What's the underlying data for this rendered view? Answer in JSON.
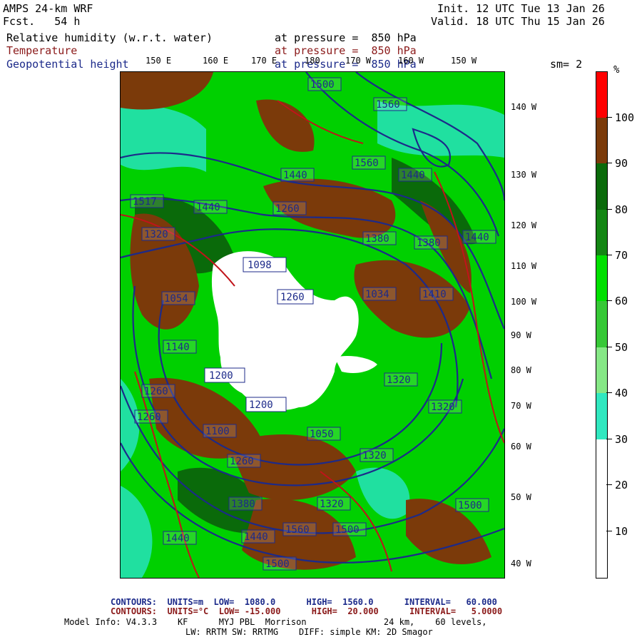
{
  "header": {
    "model_line": "AMPS 24-km WRF",
    "fcst_line": "Fcst.   54 h",
    "init_line": "Init. 12 UTC Tue 13 Jan 26",
    "valid_line": "Valid. 18 UTC Thu 15 Jan 26",
    "field1_name": "Relative humidity (w.r.t. water)",
    "field1_level": "at pressure =  850 hPa",
    "field2_name": "Temperature",
    "field2_level": "at pressure =  850 hPa",
    "field3_name": "Geopotential height",
    "field3_level": "at pressure =  850 hPa",
    "smoothing": "sm= 2"
  },
  "map": {
    "top_labels": [
      "150 E",
      "160 E",
      "170 E",
      "180",
      "170 W",
      "160 W",
      "150 W"
    ],
    "right_labels": [
      "140 W",
      "130 W",
      "120 W",
      "110 W",
      "100 W",
      "90 W",
      "80 W",
      "70 W",
      "60 W",
      "50 W",
      "40 W"
    ],
    "height_labels": [
      "1500",
      "1560",
      "1560",
      "1440",
      "1440",
      "1517",
      "1440",
      "1260",
      "1380",
      "1380",
      "1440",
      "1320",
      "1098",
      "1260",
      "1034",
      "1410",
      "1054",
      "1140",
      "1200",
      "1320",
      "1260",
      "1260",
      "1320",
      "1050",
      "1100",
      "1200",
      "1380",
      "1260",
      "1320",
      "1500",
      "1440",
      "1500",
      "1440",
      "1560",
      "1500",
      "1320"
    ],
    "colors": {
      "ice": "#ffffff",
      "rh_brown": "#7b3a0a",
      "rh_green_dark": "#0a6a0a",
      "rh_green": "#00d000",
      "rh_teal": "#20e0a0",
      "contour_height": "#1c2a8a",
      "contour_temp": "#c0141a"
    }
  },
  "colorbar": {
    "unit": "%",
    "tick_labels": [
      "100",
      "90",
      "80",
      "70",
      "60",
      "50",
      "40",
      "30",
      "20",
      "10"
    ],
    "bins": [
      {
        "range": "100+",
        "color": "#ff0000"
      },
      {
        "range": "90-100",
        "color": "#7b3a0a"
      },
      {
        "range": "80-90",
        "color": "#0a6a0a"
      },
      {
        "range": "70-80",
        "color": "#138613"
      },
      {
        "range": "60-70",
        "color": "#00e000"
      },
      {
        "range": "50-60",
        "color": "#36c836"
      },
      {
        "range": "40-50",
        "color": "#86e886"
      },
      {
        "range": "30-40",
        "color": "#30e8c0"
      },
      {
        "range": "20-30",
        "color": "#ffffff"
      },
      {
        "range": "10-20",
        "color": "#ffffff"
      },
      {
        "range": "0-10",
        "color": "#ffffff"
      }
    ]
  },
  "footer": {
    "contours1": "CONTOURS:  UNITS=m  LOW=  1080.0      HIGH=  1560.0      INTERVAL=   60.000",
    "contours2": "CONTOURS:  UNITS=°C  LOW= -15.000      HIGH=  20.000      INTERVAL=   5.0000",
    "model_info1": "Model Info: V4.3.3    KF      MYJ PBL  Morrison               24 km,    60 levels,",
    "model_info2": "LW: RRTM SW: RRTMG    DIFF: simple KM: 2D Smagor"
  }
}
